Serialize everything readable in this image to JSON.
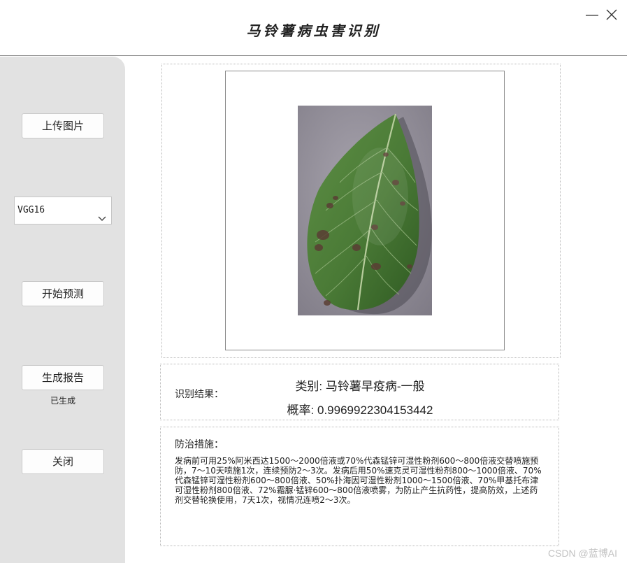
{
  "window": {
    "title": "马铃薯病虫害识别",
    "minimize_icon": "minimize-icon",
    "close_icon": "close-icon"
  },
  "sidebar": {
    "upload_label": "上传图片",
    "model_select": {
      "selected": "VGG16",
      "icon": "chevron-down-icon"
    },
    "predict_label": "开始预测",
    "report_label": "生成报告",
    "report_status": "已生成",
    "close_label": "关闭"
  },
  "result": {
    "heading": "识别结果：",
    "category_line": "类别: 马铃薯早疫病-一般",
    "probability_line": "概率: 0.9969922304153442"
  },
  "measures": {
    "heading": "防治措施：",
    "text": "发病前可用25%阿米西达1500～2000倍液或70%代森锰锌可湿性粉剂600～800倍液交替喷施预防，7～10天喷施1次，连续预防2～3次。发病后用50%速克灵可湿性粉剂800～1000倍液、70%代森锰锌可湿性粉剂600～800倍液、50%扑海因可湿性粉剂1000～1500倍液、70%甲基托布津可湿性粉剂800倍液、72%霜脲·锰锌600～800倍液喷雾，为防止产生抗药性，提高防效，上述药剂交替轮换使用，7天1次，视情况连喷2～3次。"
  },
  "watermark": "CSDN @蓝博AI",
  "colors": {
    "sidebar_bg": "#e2e2e2",
    "leaf_green": "#4f7d3a",
    "photo_bg": "#8f8c95"
  }
}
